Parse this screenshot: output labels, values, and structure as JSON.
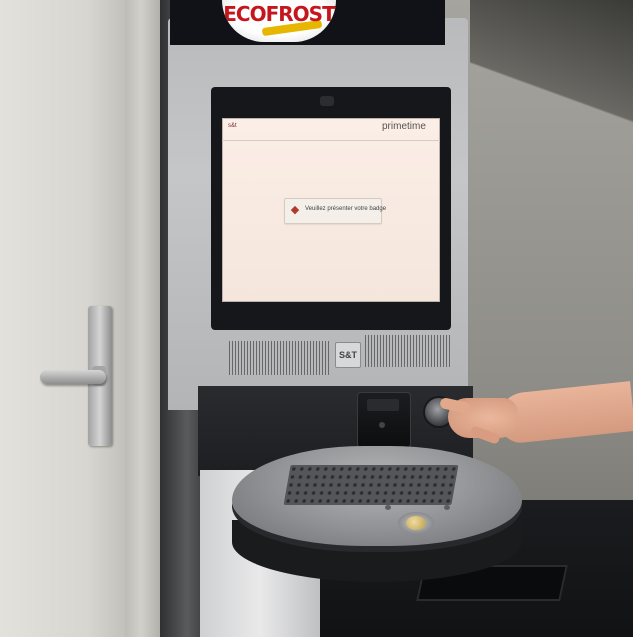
{
  "kiosk": {
    "brand_logo": "ECOFROST",
    "screen": {
      "header_left": "s&t",
      "header_right": "primetime",
      "header_right_sub": "",
      "message": "Veuillez présenter votre badge"
    },
    "plate_logo": "S&T"
  },
  "colors": {
    "logo_red": "#c4161c",
    "logo_yellow": "#e7b600",
    "screen_bg": "#f7e9e0",
    "kiosk_silver": "#bfc0c2",
    "kiosk_dark": "#1d1e21"
  }
}
